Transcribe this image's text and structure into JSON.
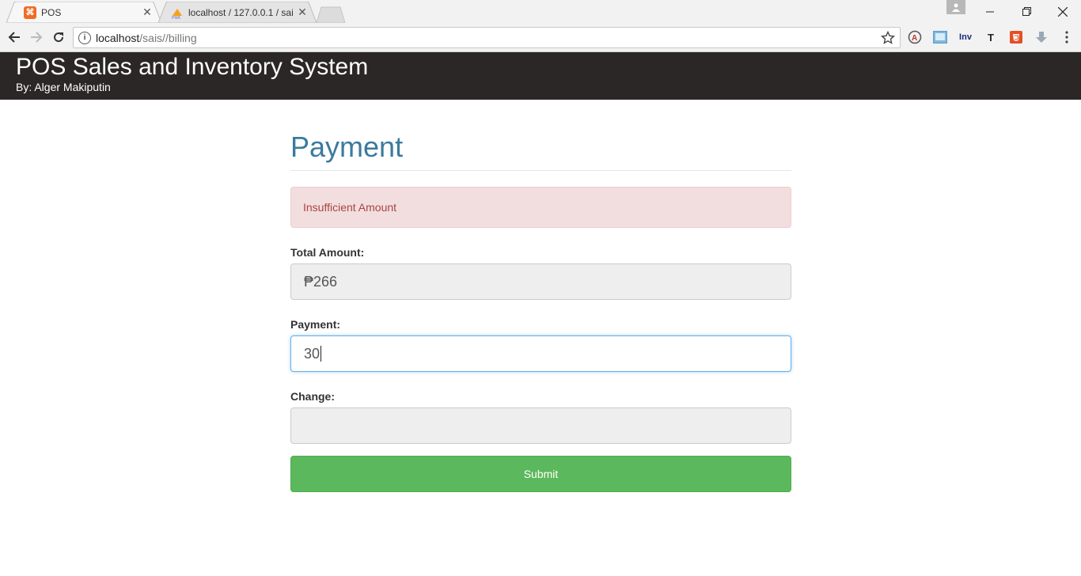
{
  "browser": {
    "tabs": [
      {
        "title": "POS",
        "favicon": "xampp-icon",
        "active": true
      },
      {
        "title": "localhost / 127.0.0.1 / sai",
        "favicon": "phpmyadmin-icon",
        "active": false
      }
    ],
    "address": {
      "host": "localhost",
      "path": "/sais//billing"
    },
    "extensions": [
      "adblock-icon",
      "bookmark-ext-icon",
      "Inv",
      "T",
      "html5-icon",
      "download-icon"
    ]
  },
  "header": {
    "title": "POS Sales and Inventory System",
    "byline": "By: Alger Makiputin"
  },
  "payment": {
    "title": "Payment",
    "alert": "Insufficient Amount",
    "total_label": "Total Amount:",
    "total_value": "₱266",
    "payment_label": "Payment:",
    "payment_value": "30",
    "change_label": "Change:",
    "change_value": "",
    "submit_label": "Submit"
  },
  "colors": {
    "header_bg": "#2b2727",
    "title": "#3b7a9e",
    "alert_bg": "#f2dede",
    "alert_text": "#a94442",
    "submit_bg": "#5cb85c"
  }
}
